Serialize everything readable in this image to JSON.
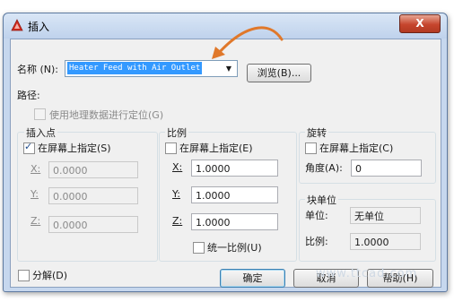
{
  "window": {
    "title": "插入",
    "close_label": "X"
  },
  "name_row": {
    "label": "名称 (N):",
    "value": "Heater Feed with Air Outlet",
    "browse_label": "浏览(B)..."
  },
  "path": {
    "label": "路径:",
    "geo_label": "使用地理数据进行定位(G)"
  },
  "insertion_point": {
    "title": "插入点",
    "on_screen_label": "在屏幕上指定(S)",
    "on_screen_checked": true,
    "x_label": "X:",
    "x_value": "0.0000",
    "y_label": "Y:",
    "y_value": "0.0000",
    "z_label": "Z:",
    "z_value": "0.0000"
  },
  "scale": {
    "title": "比例",
    "on_screen_label": "在屏幕上指定(E)",
    "on_screen_checked": false,
    "x_label": "X:",
    "x_value": "1.0000",
    "y_label": "Y:",
    "y_value": "1.0000",
    "z_label": "Z:",
    "z_value": "1.0000",
    "uniform_label": "统一比例(U)",
    "uniform_checked": false
  },
  "rotation": {
    "title": "旋转",
    "on_screen_label": "在屏幕上指定(C)",
    "on_screen_checked": false,
    "angle_label": "角度(A):",
    "angle_value": "0"
  },
  "block_unit": {
    "title": "块单位",
    "unit_label": "单位:",
    "unit_value": "无单位",
    "factor_label": "比例:",
    "factor_value": "1.0000"
  },
  "explode": {
    "label": "分解(D)",
    "checked": false
  },
  "buttons": {
    "ok": "确定",
    "cancel": "取消",
    "help": "帮助(H)"
  },
  "watermark": "www.ttcad.com",
  "colors": {
    "accent_selection": "#3399ff",
    "annotation_arrow": "#e0782a",
    "app_icon_red": "#d22a1e",
    "close_button": "#c6452d"
  }
}
